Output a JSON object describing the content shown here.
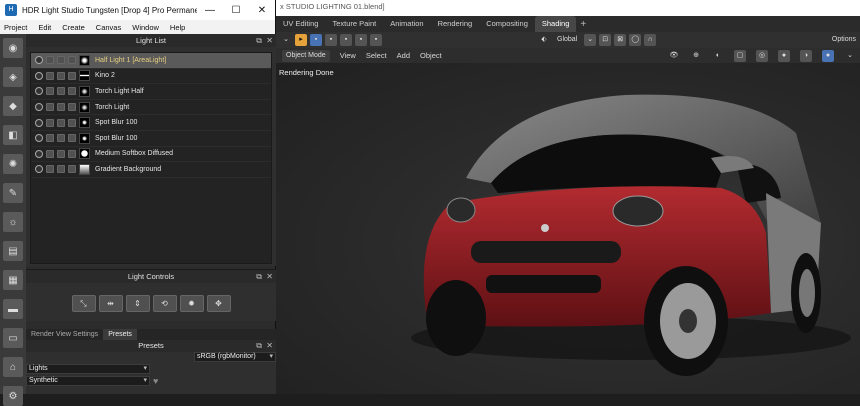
{
  "blender": {
    "title": "x STUDIO LIGHTING 01.blend]",
    "tabs": [
      "UV Editing",
      "Texture Paint",
      "Animation",
      "Rendering",
      "Compositing",
      "Shading"
    ],
    "active_tab": "Shading",
    "add_tab": "+",
    "transform_orientation": "Global",
    "options_label": "Options",
    "mode": "Object Mode",
    "menus": [
      "View",
      "Select",
      "Add",
      "Object"
    ],
    "status": "Rendering Done"
  },
  "hdr": {
    "title": "HDR Light Studio Tungsten [Drop 4]  Pro Permane...",
    "logo": "H",
    "window_controls": [
      "—",
      "☐",
      "✕"
    ],
    "menu": [
      "Project",
      "Edit",
      "Create",
      "Canvas",
      "Window",
      "Help"
    ],
    "light_list_title": "Light List",
    "lights": [
      {
        "name": "Half Light 1 [AreaLight]",
        "selected": true
      },
      {
        "name": "Kino 2",
        "selected": false
      },
      {
        "name": "Torch Light Half",
        "selected": false
      },
      {
        "name": "Torch Light",
        "selected": false
      },
      {
        "name": "Spot Blur 100",
        "selected": false
      },
      {
        "name": "Spot Blur 100",
        "selected": false
      },
      {
        "name": "Medium Softbox Diffused",
        "selected": false
      },
      {
        "name": "Gradient Background",
        "selected": false
      }
    ],
    "light_controls_title": "Light Controls",
    "light_control_icons": [
      "scale-icon",
      "move-h-icon",
      "move-v-icon",
      "rotate-icon",
      "brightness-icon",
      "spread-icon"
    ],
    "presets_tabs": [
      "Render View Settings",
      "Presets"
    ],
    "presets_active": "Presets",
    "presets_title": "Presets",
    "color_space": "sRGB (rgbMonitor)",
    "category": "Lights",
    "subcategory": "Synthetic"
  }
}
